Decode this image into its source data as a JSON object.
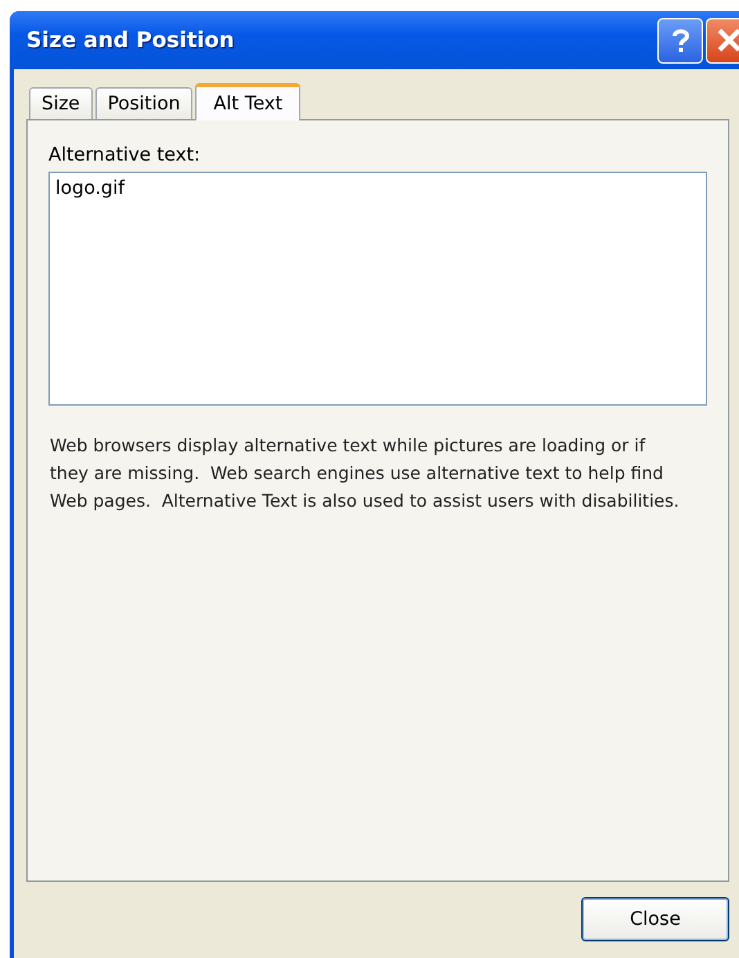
{
  "window": {
    "title": "Size and Position"
  },
  "tabs": [
    {
      "label": "Size",
      "selected": false
    },
    {
      "label": "Position",
      "selected": false
    },
    {
      "label": "Alt Text",
      "selected": true
    }
  ],
  "alt_text": {
    "label": "Alternative text:",
    "value": "logo.gif"
  },
  "description": "Web browsers display alternative text while pictures are loading or if they are missing.  Web search engines use alternative text to help find Web pages.  Alternative Text is also used to assist users with disabilities.",
  "buttons": [
    "Close"
  ]
}
